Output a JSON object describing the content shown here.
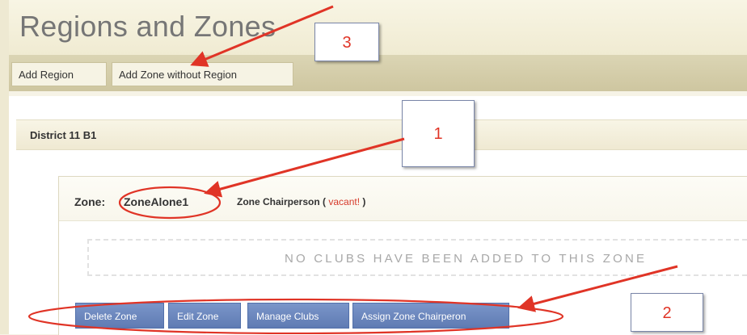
{
  "page": {
    "title": "Regions and Zones"
  },
  "toolbar": {
    "add_region": "Add Region",
    "add_zone_without_region": "Add Zone without Region"
  },
  "district": {
    "name": "District 11 B1"
  },
  "zone": {
    "prefix": "Zone:",
    "name": "ZoneAlone1",
    "chair_label": "Zone Chairperson (",
    "chair_status": "vacant!",
    "chair_close": ")",
    "empty_message": "NO CLUBS HAVE BEEN ADDED TO THIS ZONE",
    "actions": {
      "delete": "Delete Zone",
      "edit": "Edit Zone",
      "manage_clubs": "Manage Clubs",
      "assign_chair": "Assign Zone Chairperon"
    }
  },
  "annotations": {
    "callout_1": "1",
    "callout_2": "2",
    "callout_3": "3",
    "color": "#e03426"
  },
  "colors": {
    "header_bg": "#f6f3e6",
    "toolbar_bg": "#d6cfaa",
    "action_button": "#6a86bd",
    "vacant_text": "#d63a2a"
  }
}
